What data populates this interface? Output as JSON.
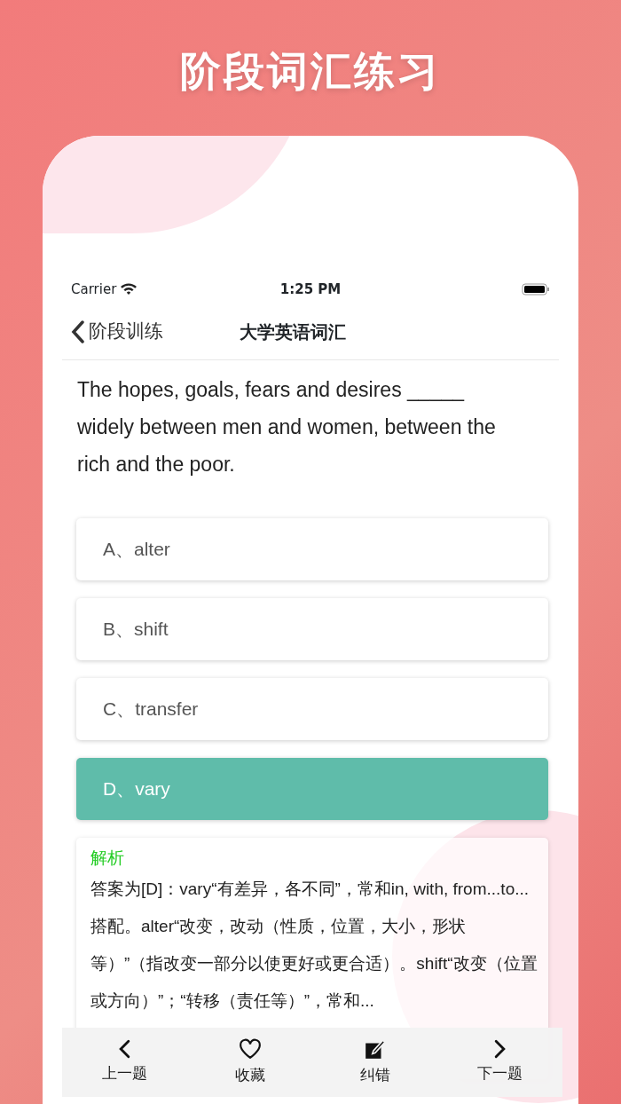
{
  "headline": "阶段词汇练习",
  "status_bar": {
    "carrier": "Carrier",
    "time": "1:25 PM"
  },
  "nav": {
    "back": "阶段训练",
    "title": "大学英语词汇"
  },
  "question": "The hopes, goals, fears and desires _____ widely between men and women, between the rich and the poor.",
  "options": [
    {
      "label": "A、alter",
      "selected": false
    },
    {
      "label": "B、shift",
      "selected": false
    },
    {
      "label": "C、transfer",
      "selected": false
    },
    {
      "label": "D、vary",
      "selected": true
    }
  ],
  "analysis": {
    "title": "解析",
    "text": "答案为[D]：vary“有差异，各不同”，常和in, with, from...to...搭配。alter“改变，改动（性质，位置，大小，形状等）”（指改变一部分以使更好或更合适）。shift“改变（位置或方向）”；“转移（责任等）”，常和..."
  },
  "toolbar": [
    {
      "kind": "prev",
      "label": "上一题"
    },
    {
      "kind": "favorite",
      "label": "收藏"
    },
    {
      "kind": "edit",
      "label": "纠错"
    },
    {
      "kind": "next",
      "label": "下一题"
    }
  ]
}
